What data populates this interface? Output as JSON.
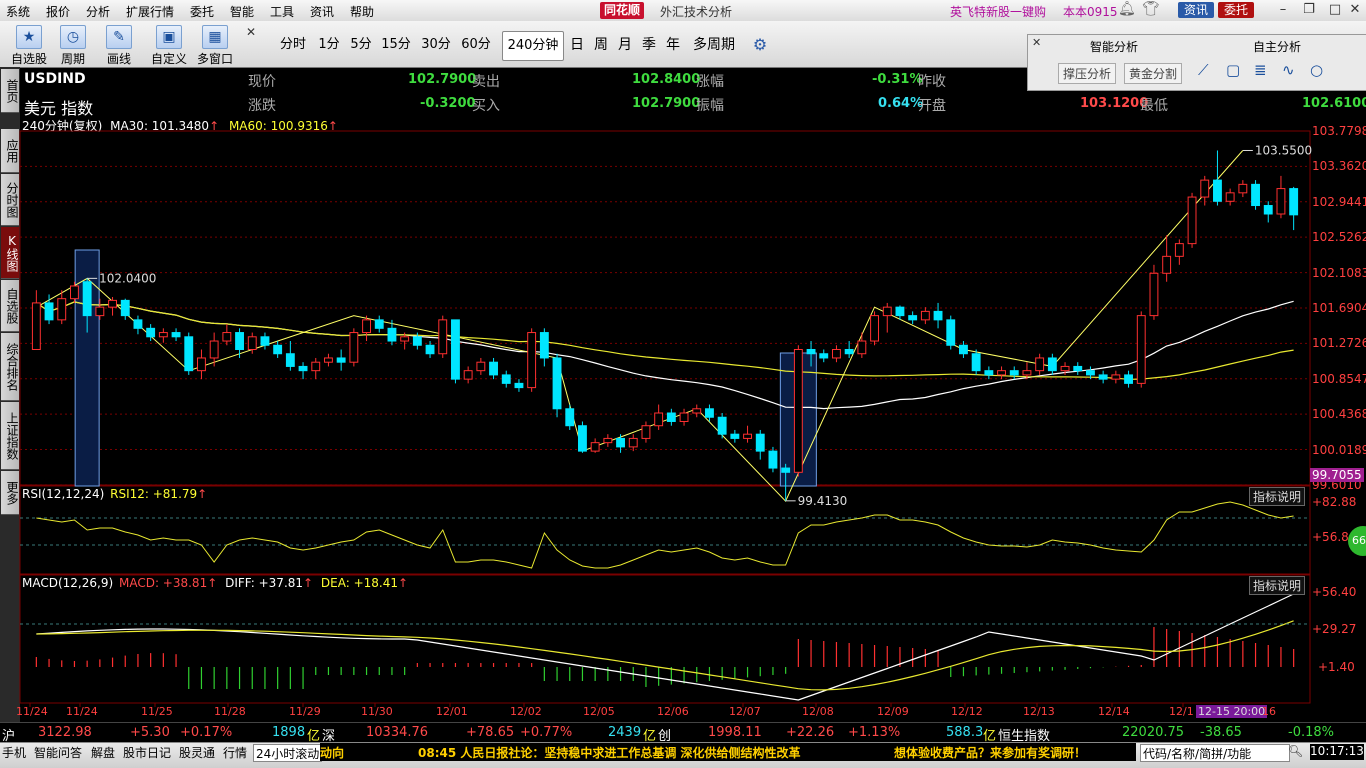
{
  "menu": [
    "系统",
    "报价",
    "分析",
    "扩展行情",
    "委托",
    "智能",
    "工具",
    "资讯",
    "帮助"
  ],
  "app": {
    "logo": "同花顺",
    "title": "外汇技术分析"
  },
  "menu_right": {
    "promo": "英飞特新股一键购",
    "version": "本本0915",
    "info": "资讯",
    "trade": "委托"
  },
  "tools": [
    "自选股",
    "周期",
    "画线",
    "自定义",
    "多窗口"
  ],
  "periods": [
    "分时",
    "1分",
    "5分",
    "15分",
    "30分",
    "60分",
    "240分钟",
    "日",
    "周",
    "月",
    "季",
    "年",
    "多周期"
  ],
  "active_period": "240分钟",
  "smart_panel": {
    "tab1": "智能分析",
    "tab2": "自主分析",
    "btn1": "撑压分析",
    "btn2": "黄金分割"
  },
  "left_tabs": [
    "首页",
    "应用",
    "分时图",
    "K线图",
    "自选股",
    "综合排名",
    "上证指数",
    "更多"
  ],
  "active_left_tab": "K线图",
  "quote": {
    "symbol": "USDIND",
    "name": "美元 指数",
    "labels": {
      "price": "现价",
      "change": "涨跌",
      "sell": "卖出",
      "buy": "买入",
      "pct": "涨幅",
      "amp": "振幅",
      "prev": "昨收",
      "open": "开盘",
      "low": "最低"
    },
    "price": "102.7900",
    "change": "-0.3200",
    "sell": "102.8400",
    "buy": "102.7900",
    "pct": "-0.31%",
    "amp": "0.64%",
    "open": "103.1200",
    "low": "102.6100"
  },
  "indicator_line": {
    "period": "240分钟(复权)",
    "ma30": "MA30: 101.3480",
    "ma60": "MA60: 100.9316"
  },
  "rsi": {
    "label": "RSI(12,12,24)",
    "value": "RSI12: +81.79",
    "explain": "指标说明",
    "y_top": "+82.88",
    "y_mid": "+56.8"
  },
  "macd": {
    "label": "MACD(12,26,9)",
    "macd": "MACD: +38.81",
    "diff": "DIFF: +37.81",
    "dea": "DEA: +18.41",
    "explain": "指标说明",
    "y_top": "+56.40",
    "y_mid": "+29.27",
    "y_low": "+1.40"
  },
  "colors": {
    "up": "#ff3030",
    "down": "#00e6ff",
    "ma30": "#ffffff",
    "ma60": "#e8e830",
    "zig": "#ffff66",
    "grid": "#7a0000"
  },
  "chart_data": {
    "type": "candlestick",
    "title": "USDIND 240分钟",
    "y_ticks": [
      "103.7798",
      "103.3620",
      "102.9441",
      "102.5262",
      "102.1083",
      "101.6904",
      "101.2726",
      "100.8547",
      "100.4368",
      "100.0189",
      "99.6010"
    ],
    "y_range": [
      99.6,
      103.78
    ],
    "last_price_tag": "99.7055",
    "annotations": [
      {
        "text": "102.0400",
        "value": 102.04
      },
      {
        "text": "103.5500",
        "value": 103.55
      },
      {
        "text": "99.4130",
        "value": 99.413
      }
    ],
    "x_labels": [
      "11/24",
      "11/24",
      "11/25",
      "11/28",
      "11/29",
      "11/30",
      "12/01",
      "12/02",
      "12/05",
      "12/06",
      "12/07",
      "12/08",
      "12/09",
      "12/12",
      "12/13",
      "12/14",
      "12/1"
    ],
    "cursor_label": "12-15 20:00",
    "cursor_after": "16",
    "candles": [
      [
        101.2,
        101.75,
        101.4,
        101.9
      ],
      [
        101.75,
        101.55,
        101.5,
        101.85
      ],
      [
        101.55,
        101.8,
        101.5,
        101.9
      ],
      [
        101.8,
        101.95,
        101.75,
        102.0
      ],
      [
        102.0,
        101.6,
        101.4,
        102.04
      ],
      [
        101.6,
        101.7,
        101.55,
        101.8
      ],
      [
        101.7,
        101.78,
        101.6,
        101.82
      ],
      [
        101.78,
        101.6,
        101.55,
        101.8
      ],
      [
        101.55,
        101.45,
        101.38,
        101.6
      ],
      [
        101.45,
        101.35,
        101.3,
        101.5
      ],
      [
        101.35,
        101.4,
        101.28,
        101.45
      ],
      [
        101.4,
        101.35,
        101.3,
        101.45
      ],
      [
        101.35,
        100.95,
        100.9,
        101.4
      ],
      [
        100.95,
        101.1,
        100.85,
        101.2
      ],
      [
        101.1,
        101.3,
        101.0,
        101.4
      ],
      [
        101.3,
        101.4,
        101.25,
        101.5
      ],
      [
        101.4,
        101.2,
        101.1,
        101.45
      ],
      [
        101.2,
        101.35,
        101.15,
        101.4
      ],
      [
        101.35,
        101.25,
        101.2,
        101.4
      ],
      [
        101.25,
        101.15,
        101.1,
        101.3
      ],
      [
        101.15,
        101.0,
        100.95,
        101.3
      ],
      [
        101.0,
        100.95,
        100.85,
        101.05
      ],
      [
        100.95,
        101.05,
        100.85,
        101.1
      ],
      [
        101.05,
        101.1,
        101.0,
        101.15
      ],
      [
        101.1,
        101.05,
        100.95,
        101.2
      ],
      [
        101.05,
        101.4,
        101.0,
        101.45
      ],
      [
        101.4,
        101.55,
        101.3,
        101.6
      ],
      [
        101.55,
        101.45,
        101.4,
        101.6
      ],
      [
        101.45,
        101.3,
        101.25,
        101.55
      ],
      [
        101.3,
        101.35,
        101.2,
        101.4
      ],
      [
        101.35,
        101.25,
        101.2,
        101.4
      ],
      [
        101.25,
        101.15,
        101.1,
        101.3
      ],
      [
        101.15,
        101.55,
        101.1,
        101.6
      ],
      [
        101.55,
        100.85,
        100.8,
        101.55
      ],
      [
        100.85,
        100.95,
        100.8,
        101.0
      ],
      [
        100.95,
        101.05,
        100.9,
        101.1
      ],
      [
        101.05,
        100.9,
        100.85,
        101.1
      ],
      [
        100.9,
        100.8,
        100.75,
        100.95
      ],
      [
        100.8,
        100.75,
        100.7,
        100.85
      ],
      [
        100.75,
        101.4,
        100.7,
        101.45
      ],
      [
        101.4,
        101.1,
        101.0,
        101.45
      ],
      [
        101.1,
        100.5,
        100.4,
        101.15
      ],
      [
        100.5,
        100.3,
        100.25,
        100.55
      ],
      [
        100.3,
        100.0,
        99.98,
        100.35
      ],
      [
        100.0,
        100.1,
        99.98,
        100.15
      ],
      [
        100.1,
        100.15,
        100.05,
        100.2
      ],
      [
        100.15,
        100.05,
        99.98,
        100.2
      ],
      [
        100.05,
        100.15,
        100.0,
        100.2
      ],
      [
        100.15,
        100.3,
        100.1,
        100.35
      ],
      [
        100.3,
        100.45,
        100.25,
        100.55
      ],
      [
        100.45,
        100.35,
        100.3,
        100.5
      ],
      [
        100.35,
        100.45,
        100.3,
        100.5
      ],
      [
        100.45,
        100.5,
        100.4,
        100.55
      ],
      [
        100.5,
        100.4,
        100.35,
        100.55
      ],
      [
        100.4,
        100.2,
        100.15,
        100.45
      ],
      [
        100.2,
        100.15,
        100.1,
        100.25
      ],
      [
        100.15,
        100.2,
        100.1,
        100.3
      ],
      [
        100.2,
        100.0,
        99.9,
        100.25
      ],
      [
        100.0,
        99.8,
        99.75,
        100.05
      ],
      [
        99.8,
        99.75,
        99.41,
        99.85
      ],
      [
        99.75,
        101.2,
        99.7,
        101.25
      ],
      [
        101.2,
        101.15,
        101.0,
        101.3
      ],
      [
        101.15,
        101.1,
        101.05,
        101.2
      ],
      [
        101.1,
        101.2,
        101.05,
        101.25
      ],
      [
        101.2,
        101.15,
        101.1,
        101.3
      ],
      [
        101.15,
        101.3,
        101.1,
        101.4
      ],
      [
        101.3,
        101.6,
        101.25,
        101.65
      ],
      [
        101.6,
        101.7,
        101.4,
        101.75
      ],
      [
        101.7,
        101.6,
        101.55,
        101.72
      ],
      [
        101.6,
        101.55,
        101.5,
        101.65
      ],
      [
        101.55,
        101.65,
        101.5,
        101.7
      ],
      [
        101.65,
        101.55,
        101.45,
        101.75
      ],
      [
        101.55,
        101.25,
        101.2,
        101.6
      ],
      [
        101.25,
        101.15,
        101.1,
        101.3
      ],
      [
        101.15,
        100.95,
        100.9,
        101.2
      ],
      [
        100.95,
        100.9,
        100.85,
        101.0
      ],
      [
        100.9,
        100.95,
        100.85,
        101.0
      ],
      [
        100.95,
        100.9,
        100.85,
        101.0
      ],
      [
        100.9,
        100.95,
        100.85,
        101.05
      ],
      [
        100.95,
        101.1,
        100.9,
        101.15
      ],
      [
        101.1,
        100.95,
        100.9,
        101.15
      ],
      [
        100.95,
        101.0,
        100.9,
        101.05
      ],
      [
        101.0,
        100.95,
        100.9,
        101.05
      ],
      [
        100.95,
        100.9,
        100.85,
        101.0
      ],
      [
        100.9,
        100.85,
        100.8,
        100.95
      ],
      [
        100.85,
        100.9,
        100.8,
        100.95
      ],
      [
        100.9,
        100.8,
        100.75,
        100.95
      ],
      [
        100.8,
        101.6,
        100.75,
        101.65
      ],
      [
        101.6,
        102.1,
        101.55,
        102.2
      ],
      [
        102.1,
        102.3,
        102.0,
        102.55
      ],
      [
        102.3,
        102.45,
        102.2,
        102.5
      ],
      [
        102.45,
        103.0,
        102.4,
        103.05
      ],
      [
        103.0,
        103.2,
        102.9,
        103.25
      ],
      [
        103.2,
        102.95,
        102.9,
        103.55
      ],
      [
        102.95,
        103.05,
        102.9,
        103.1
      ],
      [
        103.05,
        103.15,
        103.0,
        103.2
      ],
      [
        103.15,
        102.9,
        102.85,
        103.2
      ],
      [
        102.9,
        102.8,
        102.7,
        102.95
      ],
      [
        102.8,
        103.1,
        102.75,
        103.25
      ],
      [
        103.1,
        102.79,
        102.61,
        103.12
      ]
    ]
  }
}
